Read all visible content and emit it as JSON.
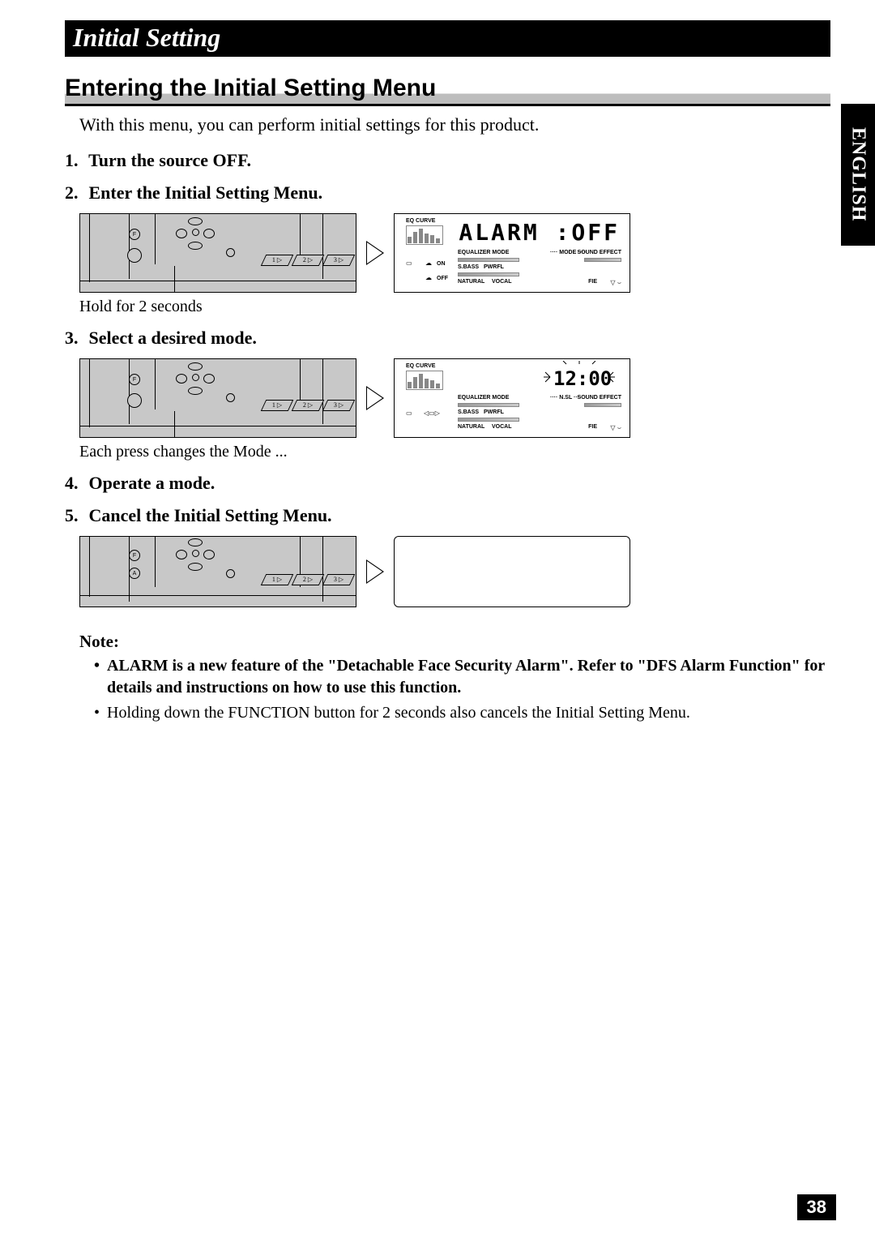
{
  "header": "Initial Setting",
  "side_tab": "ENGLISH",
  "page_number": "38",
  "section_title": "Entering the Initial Setting Menu",
  "intro": "With this menu, you can perform initial settings for this product.",
  "steps": [
    {
      "num": "1.",
      "text": "Turn the source OFF."
    },
    {
      "num": "2.",
      "text": "Enter the Initial Setting Menu."
    },
    {
      "num": "3.",
      "text": "Select a desired mode."
    },
    {
      "num": "4.",
      "text": "Operate a mode."
    },
    {
      "num": "5.",
      "text": "Cancel the Initial Setting Menu."
    }
  ],
  "captions": {
    "hold": "Hold for 2 seconds",
    "each_press": "Each press changes the Mode ..."
  },
  "display1": {
    "main": "ALARM :OFF",
    "eq_curve": "EQ CURVE",
    "equalizer_mode": "EQUALIZER MODE",
    "mode": "···· MODE ····",
    "sbass": "S.BASS",
    "pwrfl": "PWRFL",
    "sound_effect": "SOUND EFFECT",
    "natural": "NATURAL",
    "vocal": "VOCAL",
    "fie": "FIE",
    "on": "ON",
    "off": "OFF"
  },
  "display2": {
    "main": "12:00",
    "eq_curve": "EQ CURVE",
    "equalizer_mode": "EQUALIZER MODE",
    "nsl": "···· N.SL ····",
    "sbass": "S.BASS",
    "pwrfl": "PWRFL",
    "sound_effect": "SOUND EFFECT",
    "natural": "NATURAL",
    "vocal": "VOCAL",
    "fie": "FIE"
  },
  "panel": {
    "f": "F",
    "a": "A",
    "n1": "1 ▷",
    "n2": "2 ▷",
    "n3": "3 ▷"
  },
  "note_heading": "Note:",
  "notes": [
    "ALARM is a new feature of the \"Detachable Face Security Alarm\". Refer to \"DFS Alarm Function\" for details and instructions on how to use this function.",
    "Holding down the FUNCTION button for 2 seconds also cancels the Initial Setting Menu."
  ]
}
